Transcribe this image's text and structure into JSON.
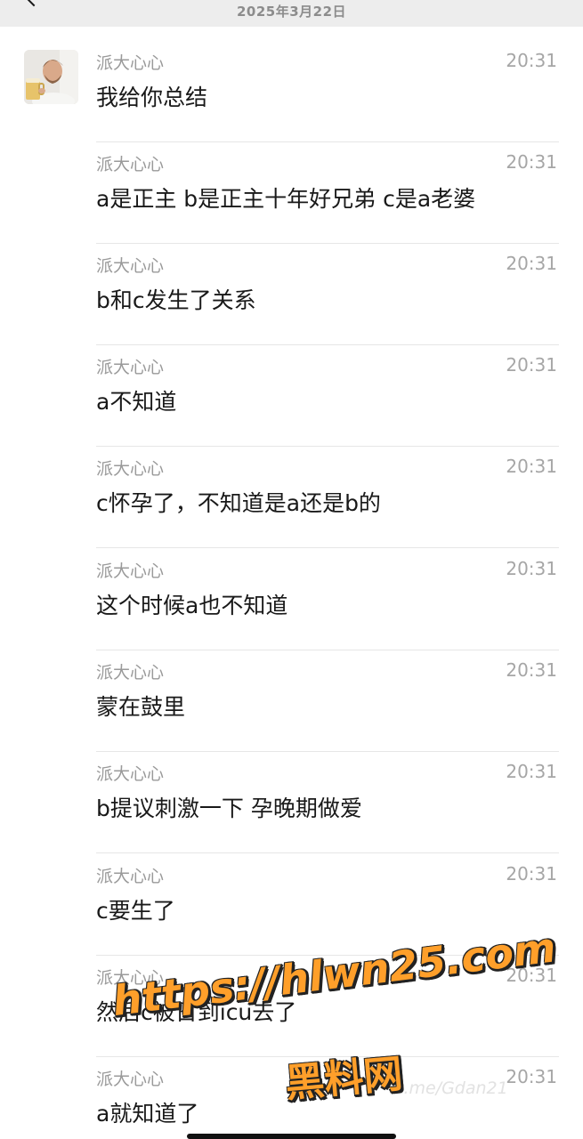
{
  "header": {
    "date": "2025年3月22日"
  },
  "messages": [
    {
      "sender": "派大心心",
      "time": "20:31",
      "text": "我给你总结"
    },
    {
      "sender": "派大心心",
      "time": "20:31",
      "text": "a是正主 b是正主十年好兄弟 c是a老婆"
    },
    {
      "sender": "派大心心",
      "time": "20:31",
      "text": "b和c发生了关系"
    },
    {
      "sender": "派大心心",
      "time": "20:31",
      "text": "a不知道"
    },
    {
      "sender": "派大心心",
      "time": "20:31",
      "text": "c怀孕了，不知道是a还是b的"
    },
    {
      "sender": "派大心心",
      "time": "20:31",
      "text": "这个时候a也不知道"
    },
    {
      "sender": "派大心心",
      "time": "20:31",
      "text": "蒙在鼓里"
    },
    {
      "sender": "派大心心",
      "time": "20:31",
      "text": "b提议刺激一下 孕晚期做爱"
    },
    {
      "sender": "派大心心",
      "time": "20:31",
      "text": "c要生了"
    },
    {
      "sender": "派大心心",
      "time": "20:31",
      "text": "然后c被日到icu去了"
    },
    {
      "sender": "派大心心",
      "time": "20:31",
      "text": "a就知道了"
    }
  ],
  "watermark": {
    "small": "t.me/Gdan21",
    "line1": "https://hlwn25.com",
    "line2": "黑料网"
  }
}
